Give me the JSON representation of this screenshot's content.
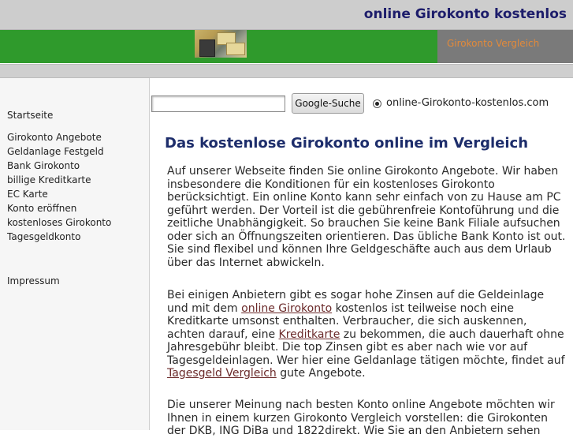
{
  "header": {
    "site_title": "online Girokonto kostenlos",
    "nav_link": "Girokonto Vergleich"
  },
  "colors": {
    "header_bg": "#cdcdcd",
    "green_bar": "#2f9a2c",
    "title_blue": "#1d1d6b",
    "link_orange": "#e28a3a",
    "link_inline": "#6b2a2a"
  },
  "sidebar": {
    "items": [
      "Startseite",
      "Girokonto Angebote",
      "Geldanlage Festgeld",
      "Bank Girokonto",
      "billige Kreditkarte",
      "EC Karte",
      "Konto eröffnen",
      "kostenloses Girokonto",
      "Tagesgeldkonto",
      "Impressum"
    ]
  },
  "search": {
    "value": "",
    "button_label": "Google-Suche",
    "radio_label": "online-Girokonto-kostenlos.com"
  },
  "main": {
    "title": "Das kostenlose Girokonto online im Vergleich",
    "para1": "Auf unserer Webseite finden Sie online Girokonto Angebote. Wir haben insbesondere die Konditionen für ein kostenloses Girokonto berücksichtigt. Ein online Konto kann sehr einfach von zu Hause am PC geführt werden. Der Vorteil ist die gebührenfreie Kontoführung und die zeitliche Unabhängigkeit. So brauchen Sie keine Bank Filiale aufsuchen oder sich an Öffnungszeiten orientieren. Das übliche Bank Konto ist out. Sie sind flexibel und können Ihre Geldgeschäfte auch aus dem Urlaub über das Internet abwickeln.",
    "para2": {
      "t1": "Bei einigen Anbietern gibt es sogar hohe Zinsen auf die Geldeinlage und mit dem ",
      "link1": "online Girokonto",
      "t2": " kostenlos ist teilweise noch eine Kreditkarte umsonst enthalten. Verbraucher, die sich auskennen, achten darauf, eine ",
      "link2": "Kreditkarte",
      "t3": " zu bekommen, die auch dauerhaft ohne Jahresgebühr bleibt. Die top Zinsen gibt es aber nach wie vor auf Tagesgeldeinlagen. Wer hier eine Geldanlage tätigen möchte, findet auf ",
      "link3": "Tagesgeld Vergleich",
      "t4": " gute Angebote."
    },
    "para3": "Die unserer Meinung nach besten Konto online Angebote möchten wir Ihnen in einem kurzen Girokonto Vergleich vorstellen: die Girokonten der DKB, ING DiBa und 1822direkt. Wie Sie an den Anbietern sehen"
  }
}
